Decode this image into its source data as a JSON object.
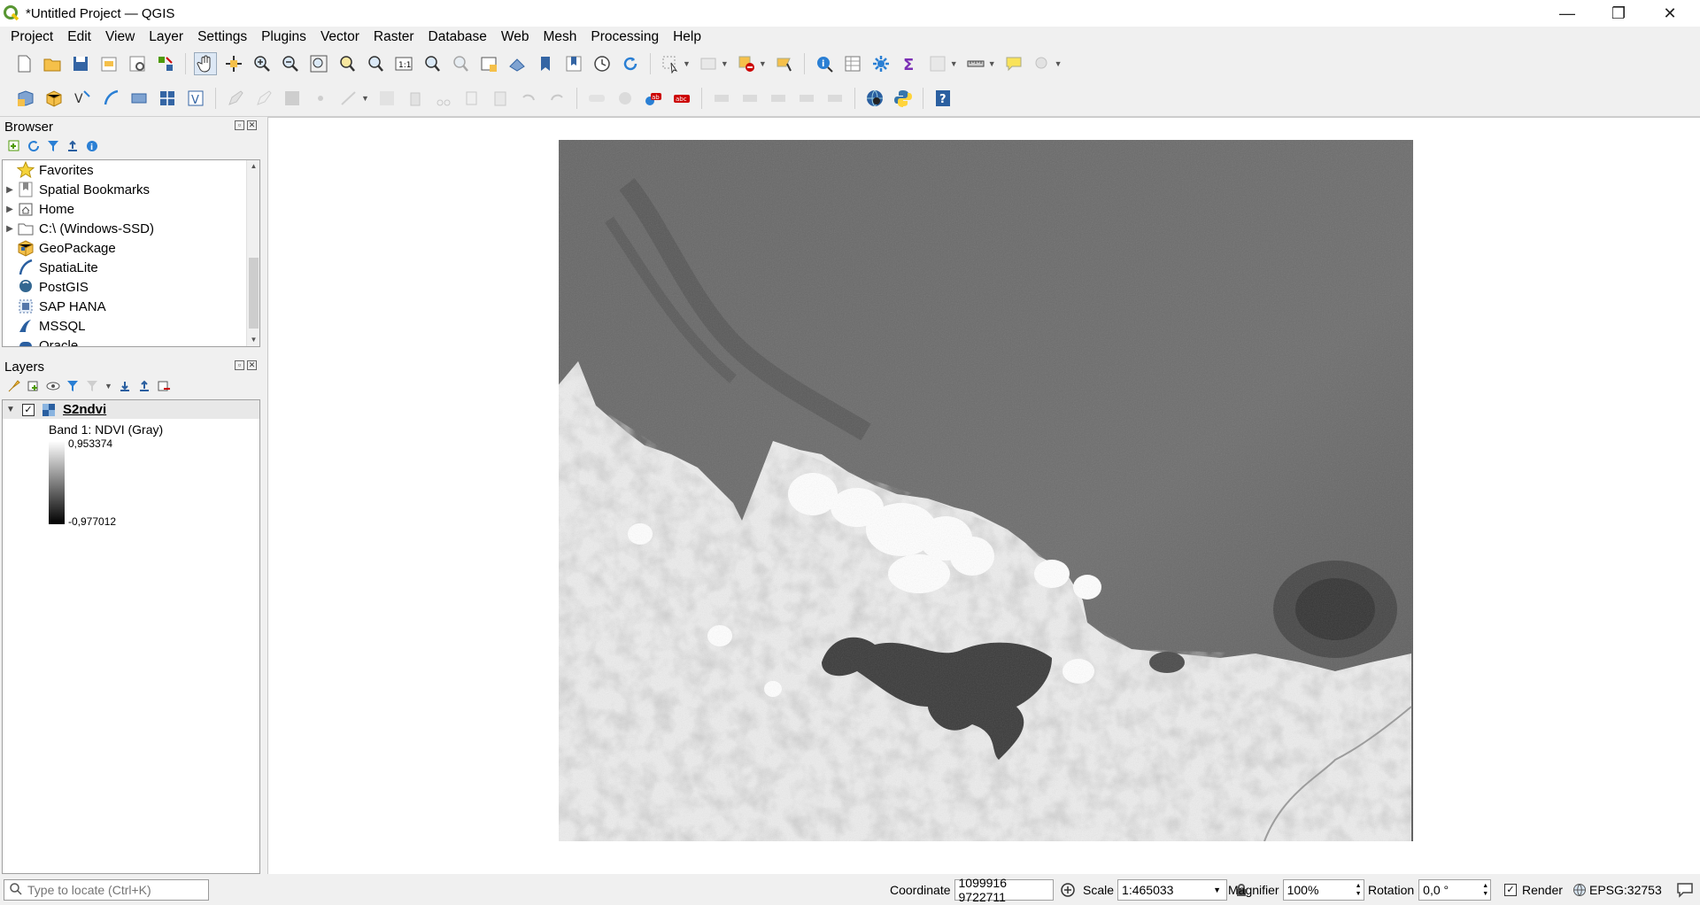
{
  "window": {
    "title": "*Untitled Project — QGIS",
    "controls": {
      "minimize": "—",
      "restore": "❐",
      "close": "✕"
    }
  },
  "menubar": [
    "Project",
    "Edit",
    "View",
    "Layer",
    "Settings",
    "Plugins",
    "Vector",
    "Raster",
    "Database",
    "Web",
    "Mesh",
    "Processing",
    "Help"
  ],
  "browser": {
    "title": "Browser",
    "items": [
      {
        "label": "Favorites",
        "icon": "star-icon",
        "expandable": false
      },
      {
        "label": "Spatial Bookmarks",
        "icon": "bookmarks-icon",
        "expandable": true
      },
      {
        "label": "Home",
        "icon": "home-folder-icon",
        "expandable": true
      },
      {
        "label": "C:\\ (Windows-SSD)",
        "icon": "drive-icon",
        "expandable": true
      },
      {
        "label": "GeoPackage",
        "icon": "geopackage-icon",
        "expandable": false
      },
      {
        "label": "SpatiaLite",
        "icon": "spatialite-icon",
        "expandable": false
      },
      {
        "label": "PostGIS",
        "icon": "postgis-icon",
        "expandable": false
      },
      {
        "label": "SAP HANA",
        "icon": "sap-hana-icon",
        "expandable": false
      },
      {
        "label": "MSSQL",
        "icon": "mssql-icon",
        "expandable": false
      },
      {
        "label": "Oracle",
        "icon": "oracle-icon",
        "expandable": false
      }
    ]
  },
  "layers": {
    "title": "Layers",
    "layer": {
      "name": "S2ndvi",
      "checked": true,
      "band": "Band 1: NDVI (Gray)",
      "max": "0,953374",
      "min": "-0,977012"
    }
  },
  "statusbar": {
    "locator_placeholder": "Type to locate (Ctrl+K)",
    "coordinate_label": "Coordinate",
    "coordinate_value": "1099916 9722711",
    "scale_label": "Scale",
    "scale_value": "1:465033",
    "magnifier_label": "Magnifier",
    "magnifier_value": "100%",
    "rotation_label": "Rotation",
    "rotation_value": "0,0 °",
    "render_label": "Render",
    "render_checked": true,
    "crs": "EPSG:32753"
  },
  "colors": {
    "accent": "#1a5fb4",
    "qgis_green": "#589632",
    "qgis_yellow": "#eec90d"
  }
}
